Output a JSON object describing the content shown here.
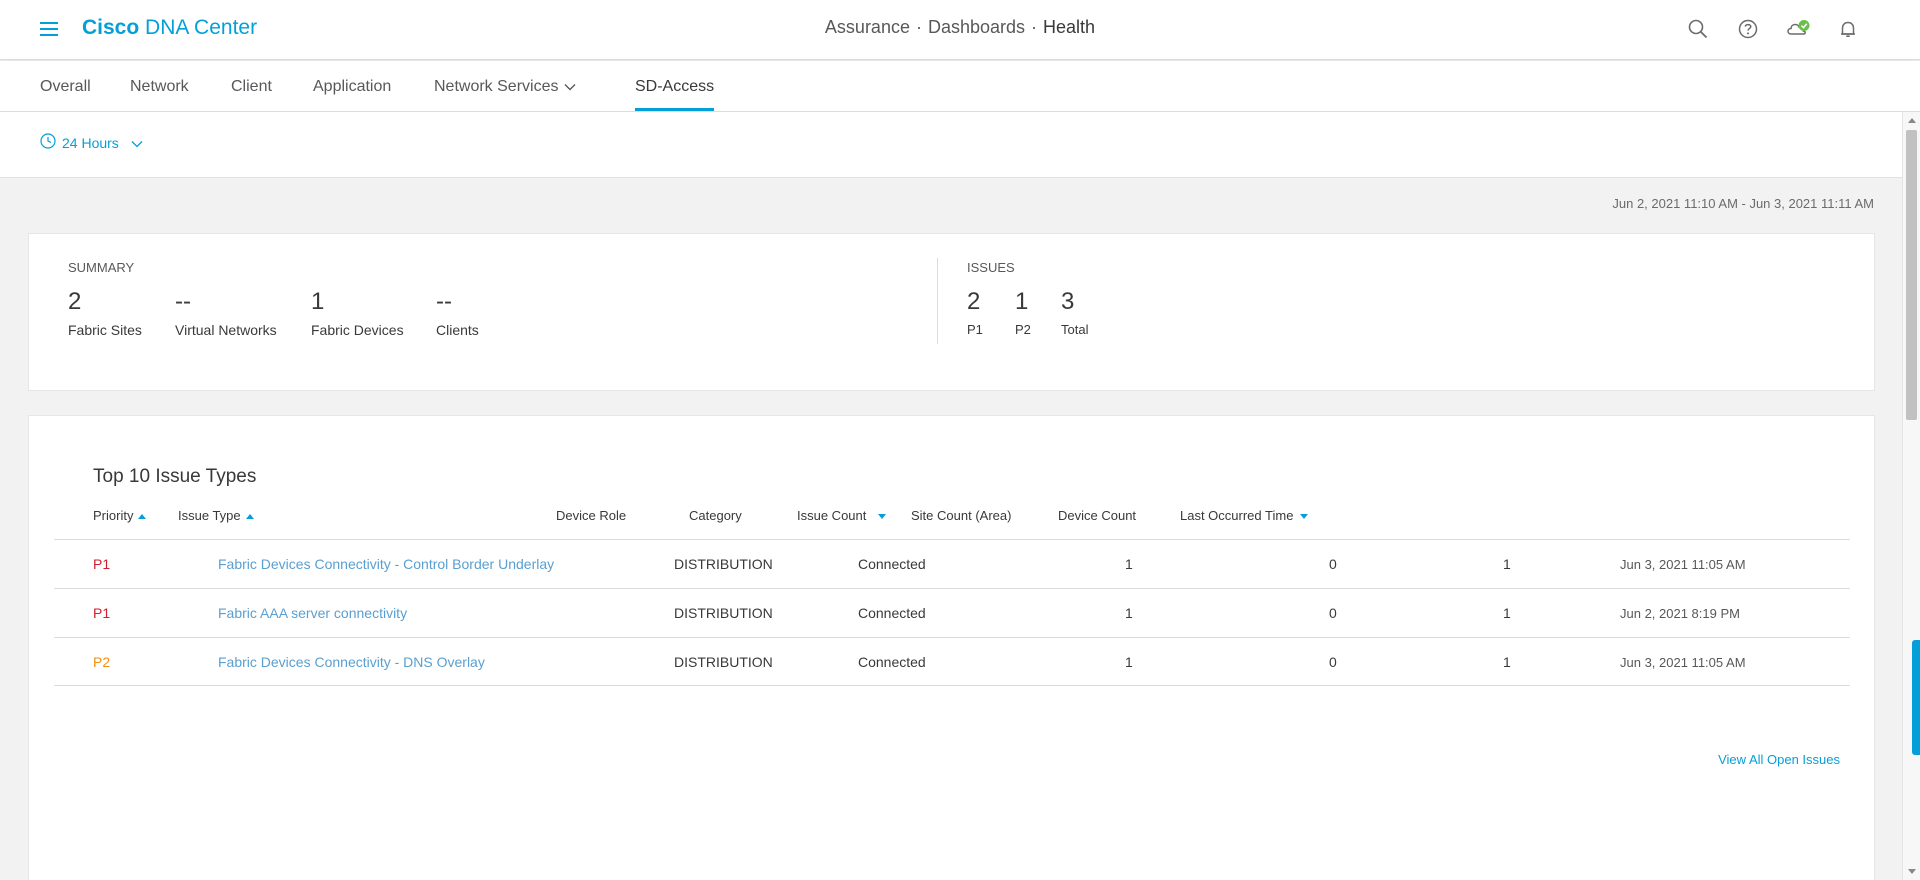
{
  "header": {
    "brand_bold": "Cisco",
    "brand_rest": "DNA Center",
    "breadcrumb": [
      "Assurance",
      "Dashboards",
      "Health"
    ],
    "breadcrumb_sep": "·",
    "icons": [
      "search-icon",
      "help-icon",
      "cloud-status-icon",
      "notification-bell-icon"
    ]
  },
  "tabs": [
    {
      "label": "Overall"
    },
    {
      "label": "Network"
    },
    {
      "label": "Client"
    },
    {
      "label": "Application"
    },
    {
      "label": "Network Services"
    },
    {
      "label": "SD-Access"
    }
  ],
  "active_tab": "SD-Access",
  "time_filter": {
    "label": "24 Hours"
  },
  "date_range": "Jun 2, 2021 11:10 AM - Jun 3, 2021 11:11 AM",
  "summary": {
    "title": "SUMMARY",
    "metrics": [
      {
        "value": "2",
        "label": "Fabric Sites"
      },
      {
        "value": "--",
        "label": "Virtual Networks"
      },
      {
        "value": "1",
        "label": "Fabric Devices"
      },
      {
        "value": "--",
        "label": "Clients"
      }
    ]
  },
  "issues_summary": {
    "title": "ISSUES",
    "metrics": [
      {
        "value": "2",
        "label": "P1"
      },
      {
        "value": "1",
        "label": "P2"
      },
      {
        "value": "3",
        "label": "Total"
      }
    ],
    "colors": {
      "p1": "#cf2030",
      "p2": "#f0900d"
    }
  },
  "top_issues": {
    "title": "Top 10 Issue Types",
    "columns": [
      "Priority",
      "Issue Type",
      "Device Role",
      "Category",
      "Issue Count",
      "Site Count (Area)",
      "Device Count",
      "Last Occurred Time"
    ],
    "rows": [
      {
        "priority": "P1",
        "issue_type": "Fabric Devices Connectivity - Control Border Underlay",
        "device_role": "DISTRIBUTION",
        "category": "Connected",
        "issue_count": "1",
        "site_count": "0",
        "device_count": "1",
        "last_occurred": "Jun 3, 2021 11:05 AM"
      },
      {
        "priority": "P1",
        "issue_type": "Fabric AAA server connectivity",
        "device_role": "DISTRIBUTION",
        "category": "Connected",
        "issue_count": "1",
        "site_count": "0",
        "device_count": "1",
        "last_occurred": "Jun 2, 2021 8:19 PM"
      },
      {
        "priority": "P2",
        "issue_type": "Fabric Devices Connectivity - DNS Overlay",
        "device_role": "DISTRIBUTION",
        "category": "Connected",
        "issue_count": "1",
        "site_count": "0",
        "device_count": "1",
        "last_occurred": "Jun 3, 2021 11:05 AM"
      }
    ],
    "view_all": "View All Open Issues"
  },
  "accent_color": "#049fd9"
}
